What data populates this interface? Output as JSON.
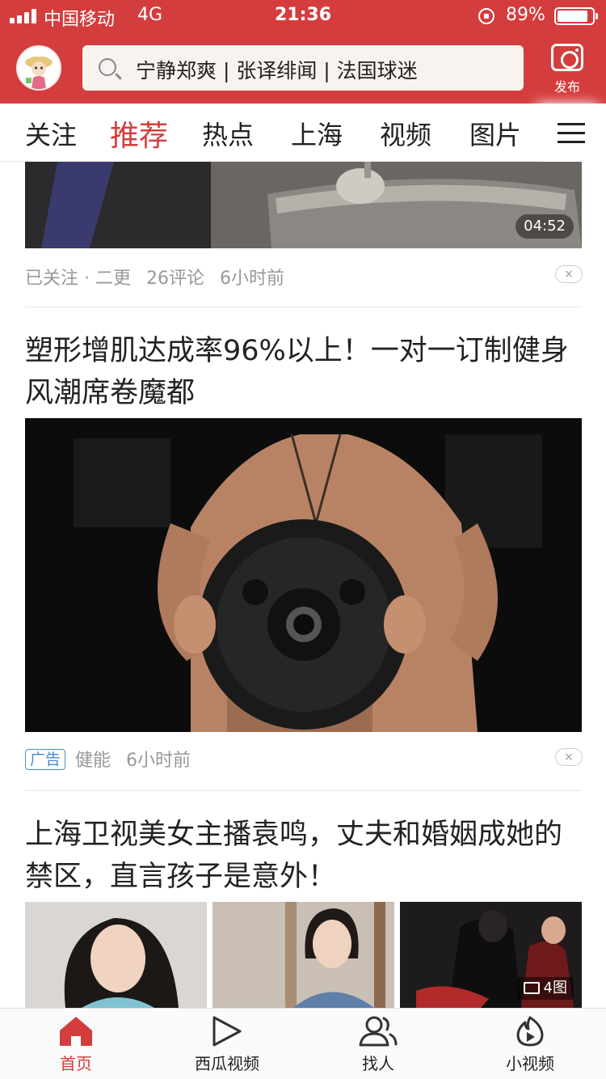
{
  "status_bar": {
    "carrier": "中国移动",
    "network": "4G",
    "time": "21:36",
    "battery": "89%",
    "battery_level": 0.89
  },
  "header": {
    "avatar_icon": "cartoon-avatar-icon",
    "search_icon": "search-icon",
    "search_suggestion": "宁静郑爽 | 张译绯闻 | 法国球迷",
    "publish_icon": "camera-icon",
    "publish_label": "发布",
    "color": "#d43d3d"
  },
  "tabs": [
    {
      "label": "关注",
      "active": false
    },
    {
      "label": "推荐",
      "active": true
    },
    {
      "label": "热点",
      "active": false
    },
    {
      "label": "上海",
      "active": false
    },
    {
      "label": "视频",
      "active": false
    },
    {
      "label": "图片",
      "active": false
    }
  ],
  "feed": {
    "item1": {
      "duration": "04:52",
      "source": "已关注 · 二更",
      "comments": "26评论",
      "time": "6小时前",
      "dislike": "×"
    },
    "item2": {
      "title": "塑形增肌达成率96%以上！一对一订制健身风潮席卷魔都",
      "badge": "广告",
      "source": "健能",
      "time": "6小时前",
      "dislike": "×"
    },
    "item3": {
      "title": "上海卫视美女主播袁鸣，丈夫和婚姻成她的禁区，直言孩子是意外！",
      "image_count": "4图"
    }
  },
  "bottom_nav": [
    {
      "label": "首页",
      "icon": "home-icon",
      "active": true
    },
    {
      "label": "西瓜视频",
      "icon": "play-icon",
      "active": false
    },
    {
      "label": "找人",
      "icon": "people-icon",
      "active": false
    },
    {
      "label": "小视频",
      "icon": "flame-play-icon",
      "active": false
    }
  ]
}
